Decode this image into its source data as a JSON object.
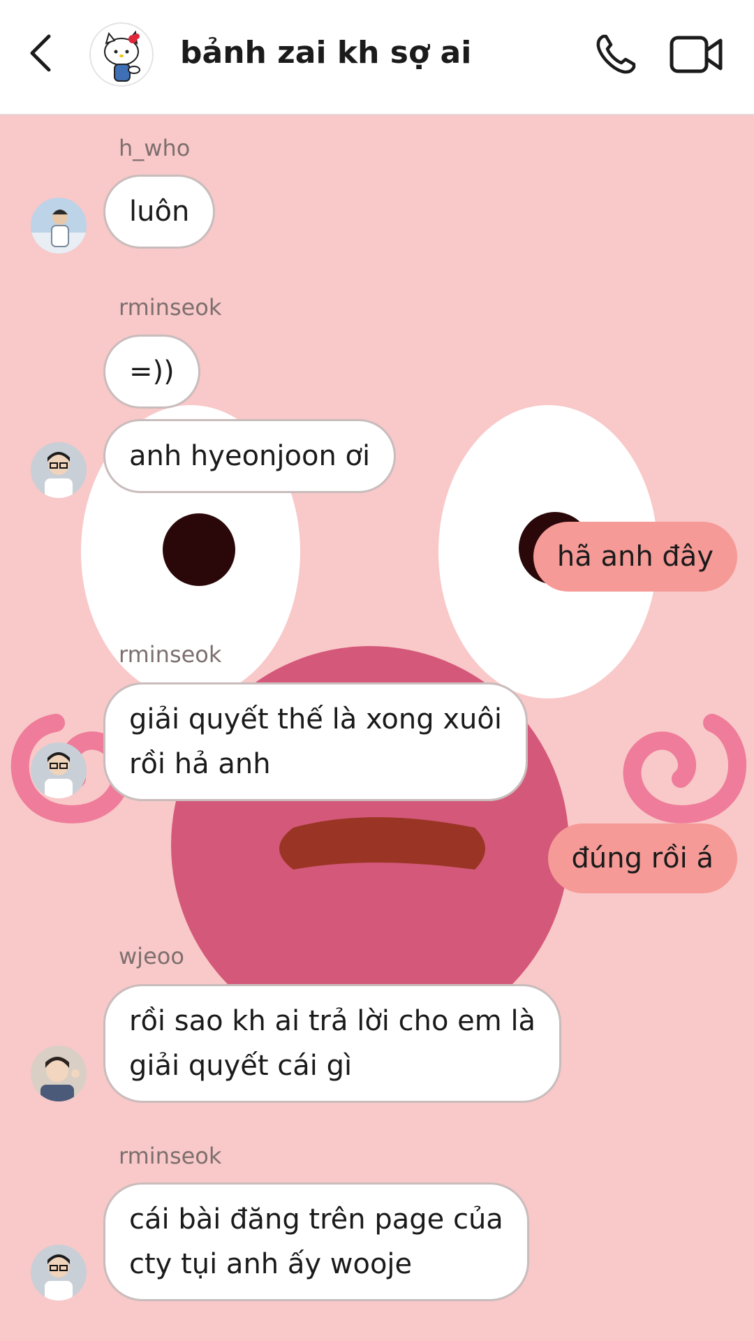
{
  "header": {
    "title": "bảnh zai kh sợ ai",
    "back_icon": "chevron-left-icon",
    "call_icon": "phone-icon",
    "video_icon": "video-camera-icon",
    "group_avatar": "hello-kitty-avatar"
  },
  "messages": [
    {
      "sender": "h_who",
      "text": "luôn",
      "direction": "incoming"
    },
    {
      "sender": "rminseok",
      "text": "=))",
      "direction": "incoming"
    },
    {
      "sender": "",
      "text": "anh hyeonjoon ơi",
      "direction": "incoming"
    },
    {
      "sender": "",
      "text": "hã anh đây",
      "direction": "outgoing"
    },
    {
      "sender": "rminseok",
      "text_line1": "giải quyết thế là xong xuôi",
      "text_line2": "rồi hả anh",
      "direction": "incoming"
    },
    {
      "sender": "",
      "text": "đúng rồi á",
      "direction": "outgoing"
    },
    {
      "sender": "wjeoo",
      "text_line1": "rồi sao kh ai trả lời cho em là",
      "text_line2": "giải quyết cái gì",
      "direction": "incoming"
    },
    {
      "sender": "rminseok",
      "text_line1": "cái bài đăng trên page của",
      "text_line2": "cty tụi anh ấy wooje",
      "direction": "incoming"
    }
  ],
  "colors": {
    "background": "#f9c8c8",
    "incoming_bubble": "#ffffff",
    "outgoing_bubble": "#f59a96",
    "header": "#ffffff"
  }
}
